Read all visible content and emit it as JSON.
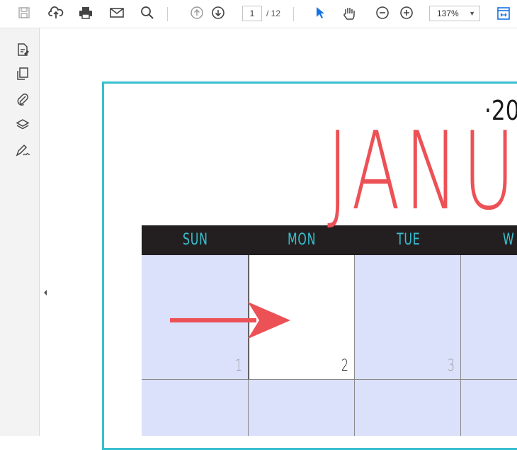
{
  "toolbar": {
    "page_current": "1",
    "page_total": "/ 12",
    "zoom": "137%",
    "icons": [
      "save-icon",
      "cloud-upload-icon",
      "print-icon",
      "email-icon",
      "search-icon",
      "previous-page-icon",
      "next-page-icon",
      "select-cursor-icon",
      "hand-tool-icon",
      "zoom-out-icon",
      "zoom-in-icon",
      "fit-page-icon"
    ]
  },
  "sidebar": {
    "icons": [
      "edit-document-icon",
      "pages-icon",
      "attachment-icon",
      "layers-icon",
      "signature-icon"
    ]
  },
  "calendar": {
    "year_partial": "·20",
    "month_partial": "JANU",
    "days": [
      "SUN",
      "MON",
      "TUE",
      "W"
    ],
    "row1": [
      "1",
      "2",
      "3"
    ],
    "colors": {
      "border": "#37bfcf",
      "month": "#ec5156",
      "header_bg": "#231f20",
      "day_text": "#37bfcf",
      "cell_shade": "#dbe0fb",
      "arrow": "#ec5156"
    }
  }
}
